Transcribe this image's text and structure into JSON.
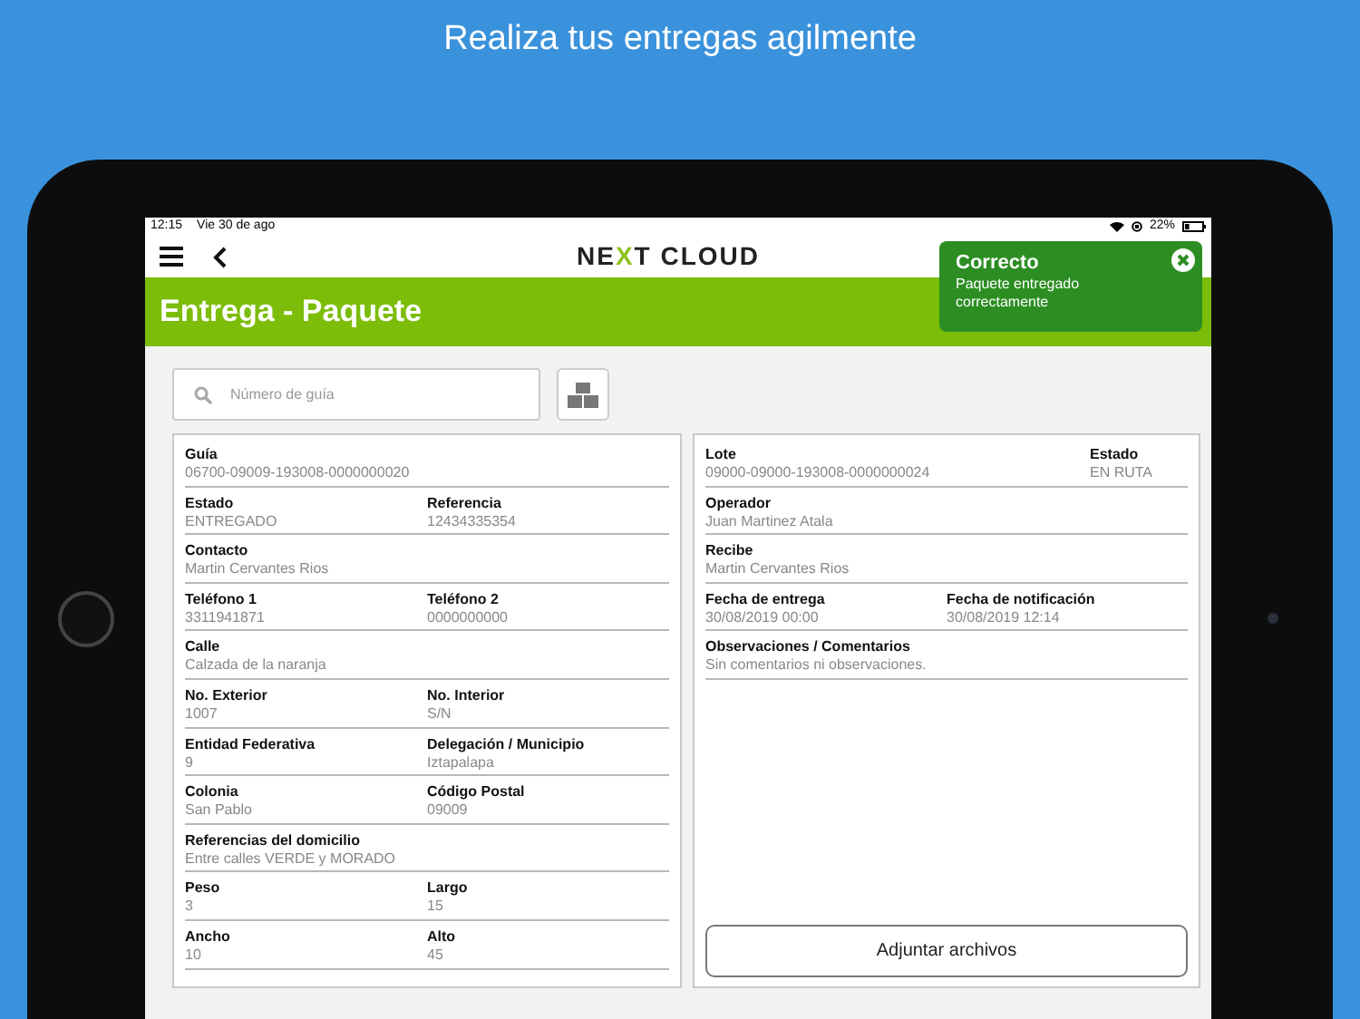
{
  "headline": "Realiza tus entregas agilmente",
  "status_bar": {
    "time": "12:15",
    "date": "Vie 30 de ago",
    "battery": "22%"
  },
  "logo": {
    "before": "NE",
    "accent": "X",
    "after": "T CLOUD"
  },
  "header": {
    "title": "Entrega - Paquete"
  },
  "toast": {
    "title": "Correcto",
    "message": "Paquete entregado correctamente"
  },
  "search": {
    "placeholder": "Número de guía"
  },
  "left_panel": {
    "rows": [
      {
        "fields": [
          {
            "label": "Guía",
            "value": "06700-09009-193008-0000000020"
          }
        ]
      },
      {
        "fields": [
          {
            "label": "Estado",
            "value": "ENTREGADO"
          },
          {
            "label": "Referencia",
            "value": "12434335354"
          }
        ]
      },
      {
        "fields": [
          {
            "label": "Contacto",
            "value": "Martin Cervantes Rios"
          }
        ]
      },
      {
        "fields": [
          {
            "label": "Teléfono 1",
            "value": "3311941871"
          },
          {
            "label": "Teléfono 2",
            "value": "0000000000"
          }
        ]
      },
      {
        "fields": [
          {
            "label": "Calle",
            "value": "Calzada de la naranja"
          }
        ]
      },
      {
        "fields": [
          {
            "label": "No. Exterior",
            "value": "1007"
          },
          {
            "label": "No. Interior",
            "value": "S/N"
          }
        ]
      },
      {
        "fields": [
          {
            "label": "Entidad Federativa",
            "value": "9"
          },
          {
            "label": "Delegación / Municipio",
            "value": "Iztapalapa"
          }
        ]
      },
      {
        "fields": [
          {
            "label": "Colonia",
            "value": "San Pablo"
          },
          {
            "label": "Código Postal",
            "value": "09009"
          }
        ]
      },
      {
        "fields": [
          {
            "label": "Referencias del domicilio",
            "value": "Entre calles VERDE y MORADO"
          }
        ]
      },
      {
        "fields": [
          {
            "label": "Peso",
            "value": "3"
          },
          {
            "label": "Largo",
            "value": "15"
          }
        ]
      },
      {
        "fields": [
          {
            "label": "Ancho",
            "value": "10"
          },
          {
            "label": "Alto",
            "value": "45"
          }
        ]
      }
    ]
  },
  "right_panel": {
    "header": {
      "main": {
        "label": "Lote",
        "value": "09000-09000-193008-0000000024"
      },
      "side": {
        "label": "Estado",
        "value": "EN RUTA"
      }
    },
    "rows": [
      {
        "fields": [
          {
            "label": "Operador",
            "value": "Juan Martinez Atala"
          }
        ]
      },
      {
        "fields": [
          {
            "label": "Recibe",
            "value": "Martin Cervantes Rios"
          }
        ]
      },
      {
        "fields": [
          {
            "label": "Fecha de entrega",
            "value": "30/08/2019 00:00"
          },
          {
            "label": "Fecha de notificación",
            "value": "30/08/2019 12:14"
          }
        ]
      },
      {
        "fields": [
          {
            "label": "Observaciones / Comentarios",
            "value": "Sin comentarios ni observaciones."
          }
        ]
      }
    ],
    "button": "Adjuntar archivos"
  }
}
